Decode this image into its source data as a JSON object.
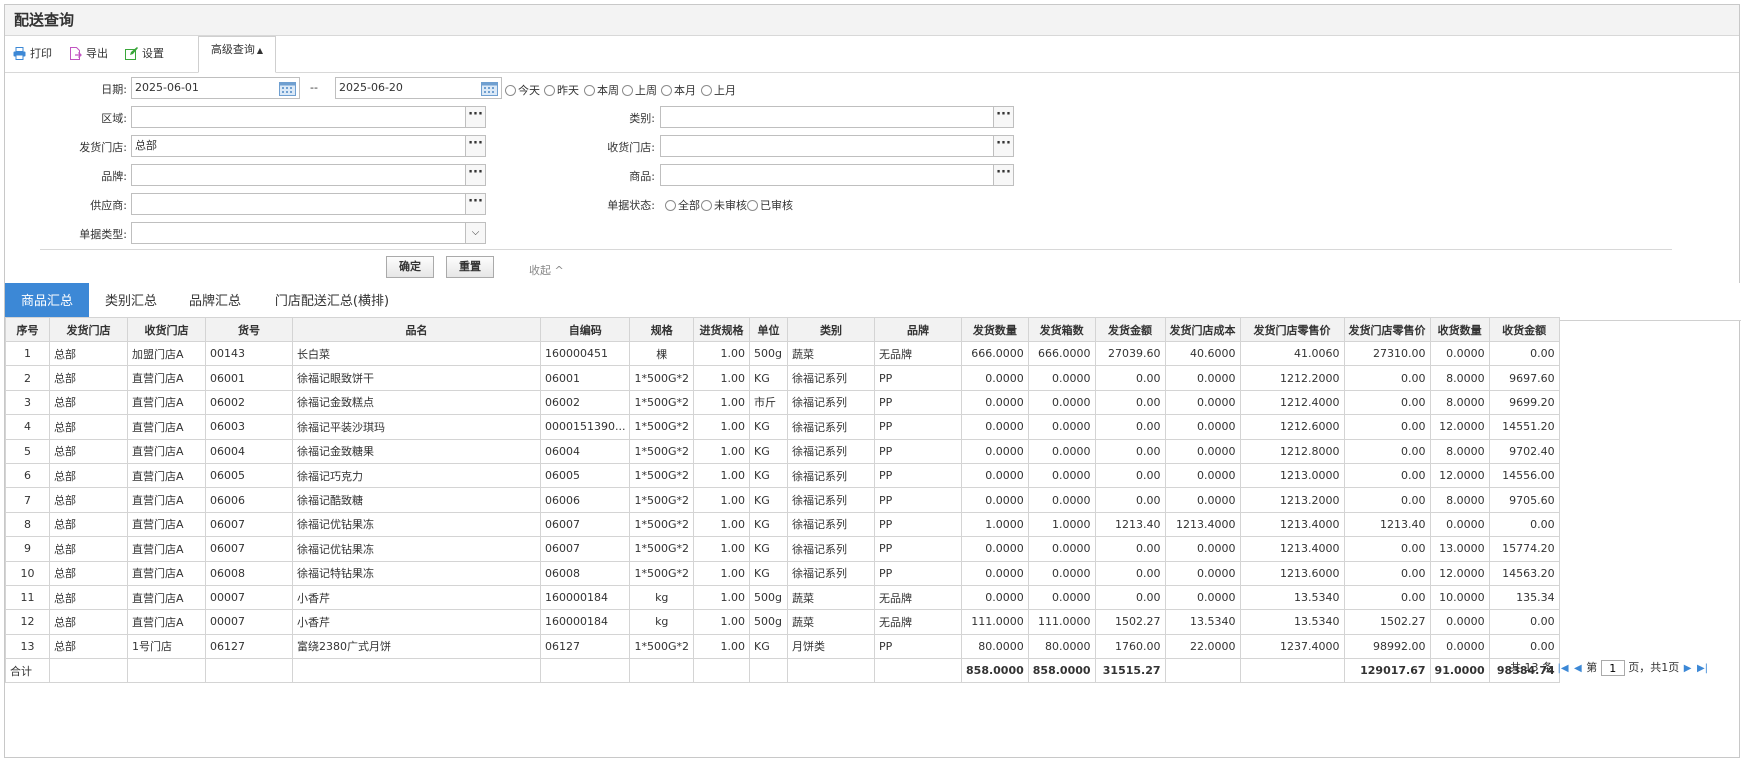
{
  "page": {
    "title": "配送查询"
  },
  "toolbar": {
    "print_label": "打印",
    "export_label": "导出",
    "settings_label": "设置",
    "advanced_label": "高级查询"
  },
  "form": {
    "date_label": "日期:",
    "date_from": "2025-06-01",
    "date_sep": "--",
    "date_to": "2025-06-20",
    "date_options": [
      "今天",
      "昨天",
      "本周",
      "上周",
      "本月",
      "上月"
    ],
    "region_label": "区域:",
    "region_value": "",
    "category_label": "类别:",
    "category_value": "",
    "send_store_label": "发货门店:",
    "send_store_value": "总部",
    "recv_store_label": "收货门店:",
    "recv_store_value": "",
    "brand_label": "品牌:",
    "brand_value": "",
    "goods_label": "商品:",
    "goods_value": "",
    "supplier_label": "供应商:",
    "supplier_value": "",
    "doc_status_label": "单据状态:",
    "doc_status_options": [
      "全部",
      "未审核",
      "已审核"
    ],
    "doc_type_label": "单据类型:",
    "doc_type_value": "",
    "confirm_label": "确定",
    "reset_label": "重置",
    "collapse_label": "收起 ^"
  },
  "tabs": [
    "商品汇总",
    "类别汇总",
    "品牌汇总",
    "门店配送汇总(横排)"
  ],
  "table": {
    "headers": [
      "序号",
      "发货门店",
      "收货门店",
      "货号",
      "品名",
      "自编码",
      "规格",
      "进货规格",
      "单位",
      "类别",
      "品牌",
      "发货数量",
      "发货箱数",
      "发货金额",
      "发货门店成本",
      "发货门店零售价",
      "发货门店零售价",
      "收货数量",
      "收货金额"
    ],
    "rows": [
      [
        "1",
        "总部",
        "加盟门店A",
        "00143",
        "长白菜",
        "160000451",
        "棵",
        "1.00",
        "500g",
        "蔬菜",
        "无品牌",
        "666.0000",
        "666.0000",
        "27039.60",
        "40.6000",
        "41.0060",
        "27310.00",
        "0.0000",
        "0.00"
      ],
      [
        "2",
        "总部",
        "直营门店A",
        "06001",
        "徐福记眼致饼干",
        "06001",
        "1*500G*2",
        "1.00",
        "KG",
        "徐福记系列",
        "PP",
        "0.0000",
        "0.0000",
        "0.00",
        "0.0000",
        "1212.2000",
        "0.00",
        "8.0000",
        "9697.60"
      ],
      [
        "3",
        "总部",
        "直营门店A",
        "06002",
        "徐福记金致糕点",
        "06002",
        "1*500G*2",
        "1.00",
        "市斤",
        "徐福记系列",
        "PP",
        "0.0000",
        "0.0000",
        "0.00",
        "0.0000",
        "1212.4000",
        "0.00",
        "8.0000",
        "9699.20"
      ],
      [
        "4",
        "总部",
        "直营门店A",
        "06003",
        "徐福记平装沙琪玛",
        "0000151390...",
        "1*500G*2",
        "1.00",
        "KG",
        "徐福记系列",
        "PP",
        "0.0000",
        "0.0000",
        "0.00",
        "0.0000",
        "1212.6000",
        "0.00",
        "12.0000",
        "14551.20"
      ],
      [
        "5",
        "总部",
        "直营门店A",
        "06004",
        "徐福记金致糖果",
        "06004",
        "1*500G*2",
        "1.00",
        "KG",
        "徐福记系列",
        "PP",
        "0.0000",
        "0.0000",
        "0.00",
        "0.0000",
        "1212.8000",
        "0.00",
        "8.0000",
        "9702.40"
      ],
      [
        "6",
        "总部",
        "直营门店A",
        "06005",
        "徐福记巧克力",
        "06005",
        "1*500G*2",
        "1.00",
        "KG",
        "徐福记系列",
        "PP",
        "0.0000",
        "0.0000",
        "0.00",
        "0.0000",
        "1213.0000",
        "0.00",
        "12.0000",
        "14556.00"
      ],
      [
        "7",
        "总部",
        "直营门店A",
        "06006",
        "徐福记酷致糖",
        "06006",
        "1*500G*2",
        "1.00",
        "KG",
        "徐福记系列",
        "PP",
        "0.0000",
        "0.0000",
        "0.00",
        "0.0000",
        "1213.2000",
        "0.00",
        "8.0000",
        "9705.60"
      ],
      [
        "8",
        "总部",
        "直营门店A",
        "06007",
        "徐福记优钻果冻",
        "06007",
        "1*500G*2",
        "1.00",
        "KG",
        "徐福记系列",
        "PP",
        "1.0000",
        "1.0000",
        "1213.40",
        "1213.4000",
        "1213.4000",
        "1213.40",
        "0.0000",
        "0.00"
      ],
      [
        "9",
        "总部",
        "直营门店A",
        "06007",
        "徐福记优钻果冻",
        "06007",
        "1*500G*2",
        "1.00",
        "KG",
        "徐福记系列",
        "PP",
        "0.0000",
        "0.0000",
        "0.00",
        "0.0000",
        "1213.4000",
        "0.00",
        "13.0000",
        "15774.20"
      ],
      [
        "10",
        "总部",
        "直营门店A",
        "06008",
        "徐福记特钻果冻",
        "06008",
        "1*500G*2",
        "1.00",
        "KG",
        "徐福记系列",
        "PP",
        "0.0000",
        "0.0000",
        "0.00",
        "0.0000",
        "1213.6000",
        "0.00",
        "12.0000",
        "14563.20"
      ],
      [
        "11",
        "总部",
        "直营门店A",
        "00007",
        "小香芹",
        "160000184",
        "kg",
        "1.00",
        "500g",
        "蔬菜",
        "无品牌",
        "0.0000",
        "0.0000",
        "0.00",
        "0.0000",
        "13.5340",
        "0.00",
        "10.0000",
        "135.34"
      ],
      [
        "12",
        "总部",
        "直营门店A",
        "00007",
        "小香芹",
        "160000184",
        "kg",
        "1.00",
        "500g",
        "蔬菜",
        "无品牌",
        "111.0000",
        "111.0000",
        "1502.27",
        "13.5340",
        "13.5340",
        "1502.27",
        "0.0000",
        "0.00"
      ],
      [
        "13",
        "总部",
        "1号门店",
        "06127",
        "富绕2380广式月饼",
        "06127",
        "1*500G*2",
        "1.00",
        "KG",
        "月饼类",
        "PP",
        "80.0000",
        "80.0000",
        "1760.00",
        "22.0000",
        "1237.4000",
        "98992.00",
        "0.0000",
        "0.00"
      ]
    ],
    "total": [
      "合计",
      "",
      "",
      "",
      "",
      "",
      "",
      "",
      "",
      "",
      "",
      "858.0000",
      "858.0000",
      "31515.27",
      "",
      "",
      "129017.67",
      "91.0000",
      "98384.74"
    ]
  },
  "pager": {
    "total_text": "共 13 条",
    "page_prefix": "第",
    "page_value": "1",
    "page_suffix": "页，共1页"
  }
}
